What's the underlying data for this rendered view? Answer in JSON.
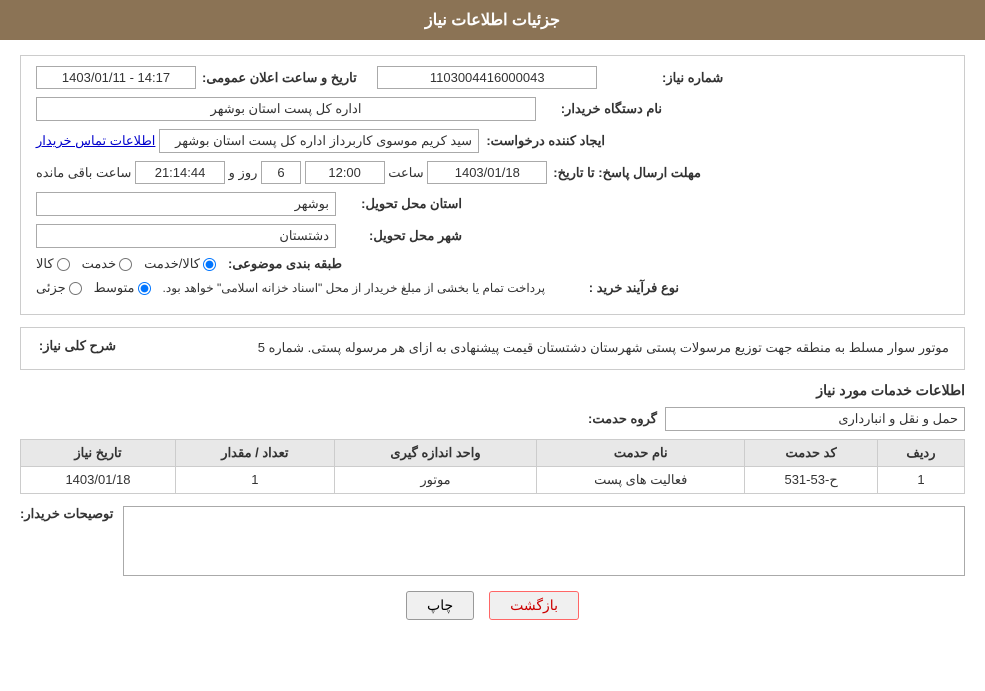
{
  "header": {
    "title": "جزئیات اطلاعات نیاز"
  },
  "fields": {
    "need_number_label": "شماره نیاز:",
    "need_number_value": "1103004416000043",
    "announce_date_label": "تاریخ و ساعت اعلان عمومی:",
    "announce_date_value": "1403/01/11 - 14:17",
    "buyer_org_label": "نام دستگاه خریدار:",
    "buyer_org_value": "اداره کل پست استان بوشهر",
    "creator_label": "ایجاد کننده درخواست:",
    "creator_value": "سید کریم موسوی کاربرداز اداره کل پست استان بوشهر",
    "contact_link": "اطلاعات تماس خریدار",
    "response_deadline_label": "مهلت ارسال پاسخ: تا تاریخ:",
    "response_date_value": "1403/01/18",
    "response_time_label": "ساعت",
    "response_time_value": "12:00",
    "response_days_label": "روز و",
    "response_days_value": "6",
    "response_remaining_label": "ساعت باقی مانده",
    "response_remaining_value": "21:14:44",
    "province_label": "استان محل تحویل:",
    "province_value": "بوشهر",
    "city_label": "شهر محل تحویل:",
    "city_value": "دشتستان",
    "category_label": "طبقه بندی موضوعی:",
    "category_options": [
      "کالا",
      "خدمت",
      "کالا/خدمت"
    ],
    "category_selected": "کالا/خدمت",
    "purchase_type_label": "نوع فرآیند خرید :",
    "purchase_options": [
      "جزئی",
      "متوسط"
    ],
    "purchase_selected": "متوسط",
    "purchase_note": "پرداخت تمام یا بخشی از مبلغ خریدار از محل \"اسناد خزانه اسلامی\" خواهد بود.",
    "col_badge": "Col"
  },
  "description_section": {
    "label": "شرح کلی نیاز:",
    "text": "موتور سوار مسلط به منطقه جهت توزیع مرسولات پستی شهرستان دشتستان قیمت پیشنهادی به ازای هر مرسوله پستی. شماره 5"
  },
  "services_section": {
    "title": "اطلاعات خدمات مورد نیاز",
    "group_label": "گروه حدمت:",
    "group_value": "حمل و نقل و انبارداری",
    "table": {
      "headers": [
        "ردیف",
        "کد حدمت",
        "نام حدمت",
        "واحد اندازه گیری",
        "تعداد / مقدار",
        "تاریخ نیاز"
      ],
      "rows": [
        {
          "row": "1",
          "service_code": "ح-53-531",
          "service_name": "فعالیت های پست",
          "unit": "موتور",
          "quantity": "1",
          "date": "1403/01/18"
        }
      ]
    }
  },
  "buyer_notes": {
    "label": "توصیحات خریدار:"
  },
  "buttons": {
    "print_label": "چاپ",
    "back_label": "بازگشت"
  }
}
